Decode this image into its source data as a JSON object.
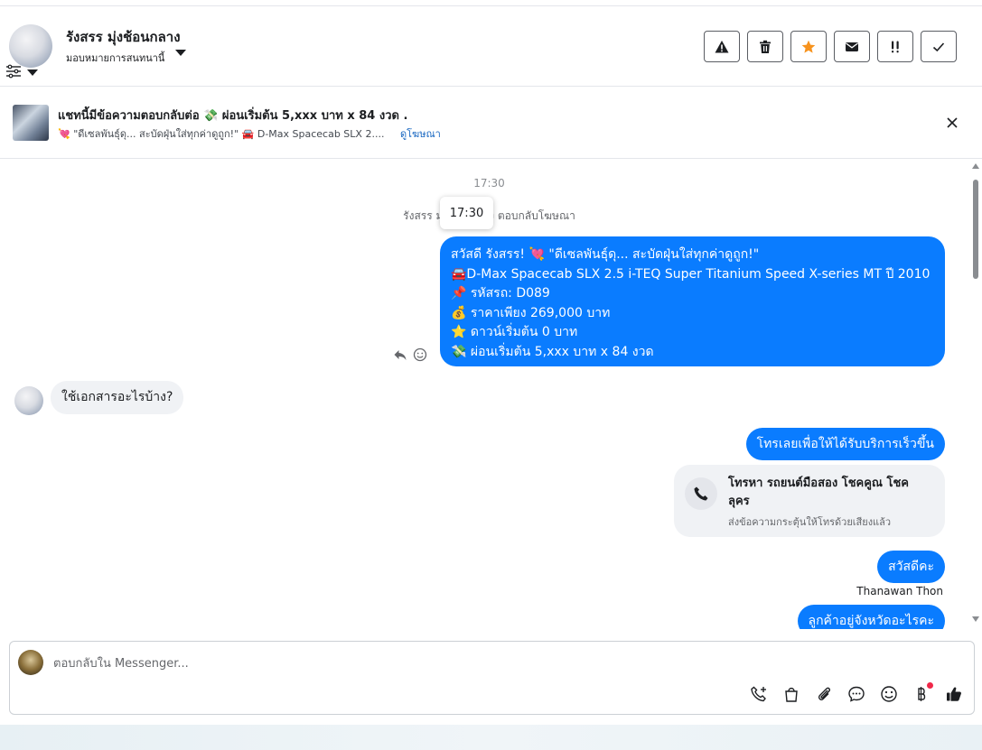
{
  "header": {
    "contact_name": "รังสรร มุ่งช้อนกลาง",
    "assign_label": "มอบหมายการสนทนานี้",
    "actions": [
      {
        "icon": "warning-icon",
        "name": "report-spam-button"
      },
      {
        "icon": "trash-icon",
        "name": "delete-button"
      },
      {
        "icon": "star-icon",
        "name": "star-button",
        "color": "#f7931e"
      },
      {
        "icon": "envelope-icon",
        "name": "mark-unread-button"
      },
      {
        "icon": "follow-up-icon",
        "name": "follow-up-button"
      },
      {
        "icon": "check-icon",
        "name": "mark-done-button"
      }
    ]
  },
  "ad_banner": {
    "title": "แชทนี้มีข้อความตอบกลับต่อ 💸 ผ่อนเริ่มต้น 5,xxx บาท x 84 งวด .",
    "snippet": "💘 \"ดีเซลพันธุ์ดุ... สะบัดฝุ่นใส่ทุกค่าดูถูก!\" 🚘 D-Max Spacecab SLX 2....",
    "view_ad_link": "ดูโฆษณา"
  },
  "chat": {
    "timestamp": "17:30",
    "tooltip_time": "17:30",
    "system_message": "รังสรร มุ่งช้อนกลาง ตอบกลับโฆษณา",
    "outgoing_ad_message_lines": [
      "สวัสดี รังสรร! 💘 \"ดีเซลพันธุ์ดุ... สะบัดฝุ่นใส่ทุกค่าดูถูก!\"",
      "🚘D-Max Spacecab SLX 2.5 i-TEQ Super Titanium Speed X-series MT ปี 2010",
      "📌 รหัสรถ: D089",
      "💰 ราคาเพียง 269,000 บาท",
      "⭐ ดาวน์เริ่มต้น 0 บาท",
      "💸 ผ่อนเริ่มต้น 5,xxx บาท x 84 งวด"
    ],
    "incoming_message": "ใช้เอกสารอะไรบ้าง?",
    "outgoing_call_prompt": "โทรเลยเพื่อให้ได้รับบริการเร็วขึ้น",
    "call_card": {
      "title": "โทรหา รถยนต์มือสอง โชคคูณ โชค ลุคร",
      "subtitle": "ส่งข้อความกระตุ้นให้โทรด้วยเสียงแล้ว"
    },
    "outgoing_greeting": "สวัสดีคะ",
    "sender_name": "Thanawan Thon",
    "outgoing_province_question": "ลูกค้าอยู่จังหวัดอะไรคะ"
  },
  "composer": {
    "placeholder": "ตอบกลับใน Messenger...",
    "tools": [
      "phone-plus-icon",
      "shopping-bag-icon",
      "paperclip-icon",
      "saved-reply-icon",
      "emoji-icon",
      "baht-icon",
      "thumbs-up-icon"
    ]
  },
  "colors": {
    "outgoing_bubble": "#0a7cff",
    "incoming_bubble": "#f0f2f5",
    "link": "#1565c0",
    "star": "#f7931e",
    "notification_dot": "#f02849"
  }
}
